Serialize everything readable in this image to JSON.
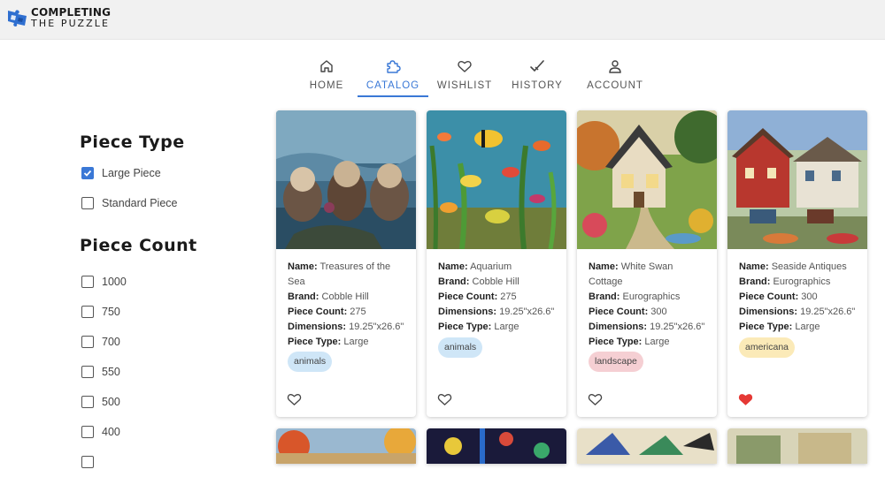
{
  "logo": {
    "line1": "COMPLETING",
    "line2": "THE PUZZLE"
  },
  "nav": {
    "home": "HOME",
    "catalog": "CATALOG",
    "wishlist": "WISHLIST",
    "history": "HISTORY",
    "account": "ACCOUNT"
  },
  "filters": {
    "piece_type_title": "Piece Type",
    "piece_type": [
      {
        "label": "Large Piece",
        "checked": true
      },
      {
        "label": "Standard Piece",
        "checked": false
      }
    ],
    "piece_count_title": "Piece Count",
    "piece_count": [
      "1000",
      "750",
      "700",
      "550",
      "500",
      "400"
    ]
  },
  "field_labels": {
    "name": "Name:",
    "brand": "Brand:",
    "count": "Piece Count:",
    "dims": "Dimensions:",
    "type": "Piece Type:"
  },
  "products": [
    {
      "name": "Treasures of the Sea",
      "brand": "Cobble Hill",
      "count": "275",
      "dims": "19.25\"x26.6\"",
      "type": "Large",
      "tag": "animals",
      "tag_color": "#cfe6f7",
      "favorited": false
    },
    {
      "name": "Aquarium",
      "brand": "Cobble Hill",
      "count": "275",
      "dims": "19.25\"x26.6\"",
      "type": "Large",
      "tag": "animals",
      "tag_color": "#cfe6f7",
      "favorited": false
    },
    {
      "name": "White Swan Cottage",
      "brand": "Eurographics",
      "count": "300",
      "dims": "19.25\"x26.6\"",
      "type": "Large",
      "tag": "landscape",
      "tag_color": "#f5cfd3",
      "favorited": false
    },
    {
      "name": "Seaside Antiques",
      "brand": "Eurographics",
      "count": "300",
      "dims": "19.25\"x26.6\"",
      "type": "Large",
      "tag": "americana",
      "tag_color": "#fbeab8",
      "favorited": true
    }
  ],
  "colors": {
    "accent": "#3a78d6",
    "heart_filled": "#e53935"
  }
}
